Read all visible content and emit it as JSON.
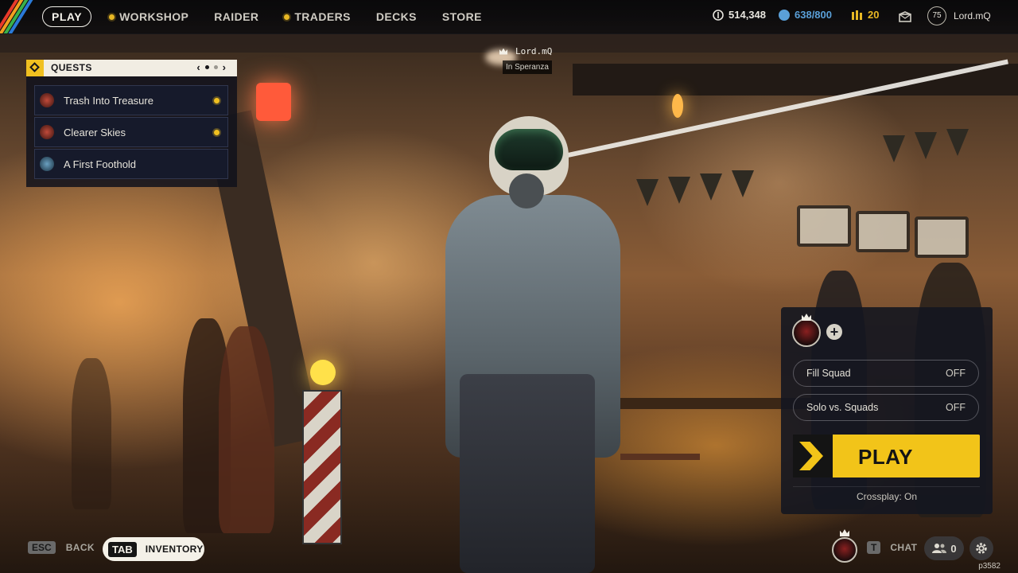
{
  "topbar": {
    "nav": [
      {
        "label": "PLAY",
        "active": true,
        "dot": false
      },
      {
        "label": "WORKSHOP",
        "active": false,
        "dot": true
      },
      {
        "label": "RAIDER",
        "active": false,
        "dot": false
      },
      {
        "label": "TRADERS",
        "active": false,
        "dot": true
      },
      {
        "label": "DECKS",
        "active": false,
        "dot": false
      },
      {
        "label": "STORE",
        "active": false,
        "dot": false
      }
    ],
    "currencies": [
      {
        "icon": "coins-icon",
        "value": "514,348",
        "color": "#e8e6df"
      },
      {
        "icon": "crafting-credits-icon",
        "value": "638/800",
        "color": "#5aa0d8"
      },
      {
        "icon": "raider-tokens-icon",
        "value": "20",
        "color": "#e8b824"
      }
    ],
    "profile": {
      "level": "75",
      "name": "Lord.mQ"
    }
  },
  "quests": {
    "title": "QUESTS",
    "prev": "‹",
    "next": "›",
    "pages": 3,
    "current_page": 1,
    "items": [
      {
        "label": "Trash Into Treasure",
        "tracked": true,
        "icon_color": "#8a2a22"
      },
      {
        "label": "Clearer Skies",
        "tracked": true,
        "icon_color": "#8a2a22"
      },
      {
        "label": "A First Foothold",
        "tracked": false,
        "icon_color": "#3a6a8a"
      }
    ]
  },
  "nameplate": {
    "name": "Lord.mQ",
    "location": "In Speranza"
  },
  "squad": {
    "add_label": "+",
    "toggles": [
      {
        "label": "Fill Squad",
        "state": "OFF"
      },
      {
        "label": "Solo vs. Squads",
        "state": "OFF"
      }
    ],
    "play_label": "PLAY",
    "crossplay": "Crossplay: On"
  },
  "bottombar": {
    "back_key": "ESC",
    "back_label": "BACK",
    "inventory_key": "TAB",
    "inventory_label": "INVENTORY",
    "chat_key": "T",
    "chat_label": "CHAT",
    "friends_count": "0",
    "build": "p3582"
  },
  "colors": {
    "accent": "#f2c419",
    "panel": "#141620",
    "text": "#e8e6df"
  }
}
